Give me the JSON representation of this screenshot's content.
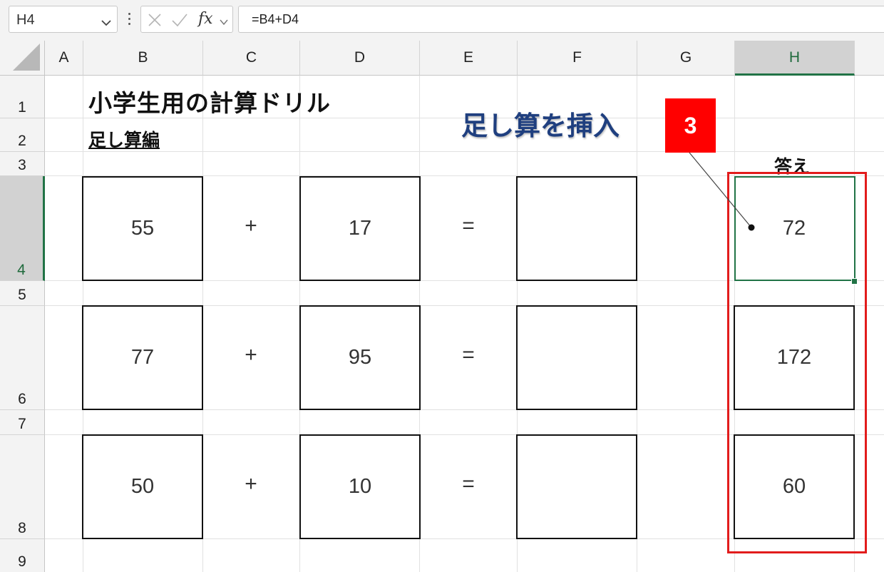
{
  "formula_bar": {
    "name_box": "H4",
    "formula": "=B4+D4"
  },
  "columns": [
    "A",
    "B",
    "C",
    "D",
    "E",
    "F",
    "G",
    "H"
  ],
  "rows": [
    "1",
    "2",
    "3",
    "4",
    "5",
    "6",
    "7",
    "8",
    "9"
  ],
  "sheet": {
    "title": "小学生用の計算ドリル",
    "subtitle": "足し算編",
    "answer_header": "答え",
    "problems": [
      {
        "a": "55",
        "op": "+",
        "b": "17",
        "eq": "=",
        "answer": "72"
      },
      {
        "a": "77",
        "op": "+",
        "b": "95",
        "eq": "=",
        "answer": "172"
      },
      {
        "a": "50",
        "op": "+",
        "b": "10",
        "eq": "=",
        "answer": "60"
      }
    ]
  },
  "annotation": {
    "callout": "足し算を挿入",
    "step": "3",
    "highlight_color": "#e21c1c",
    "callout_color": "#1f3f7f"
  },
  "icons": {
    "name_box_dropdown": "chevron-down-icon",
    "cancel": "close-icon",
    "enter": "check-icon",
    "insert_function": "fx-icon"
  }
}
